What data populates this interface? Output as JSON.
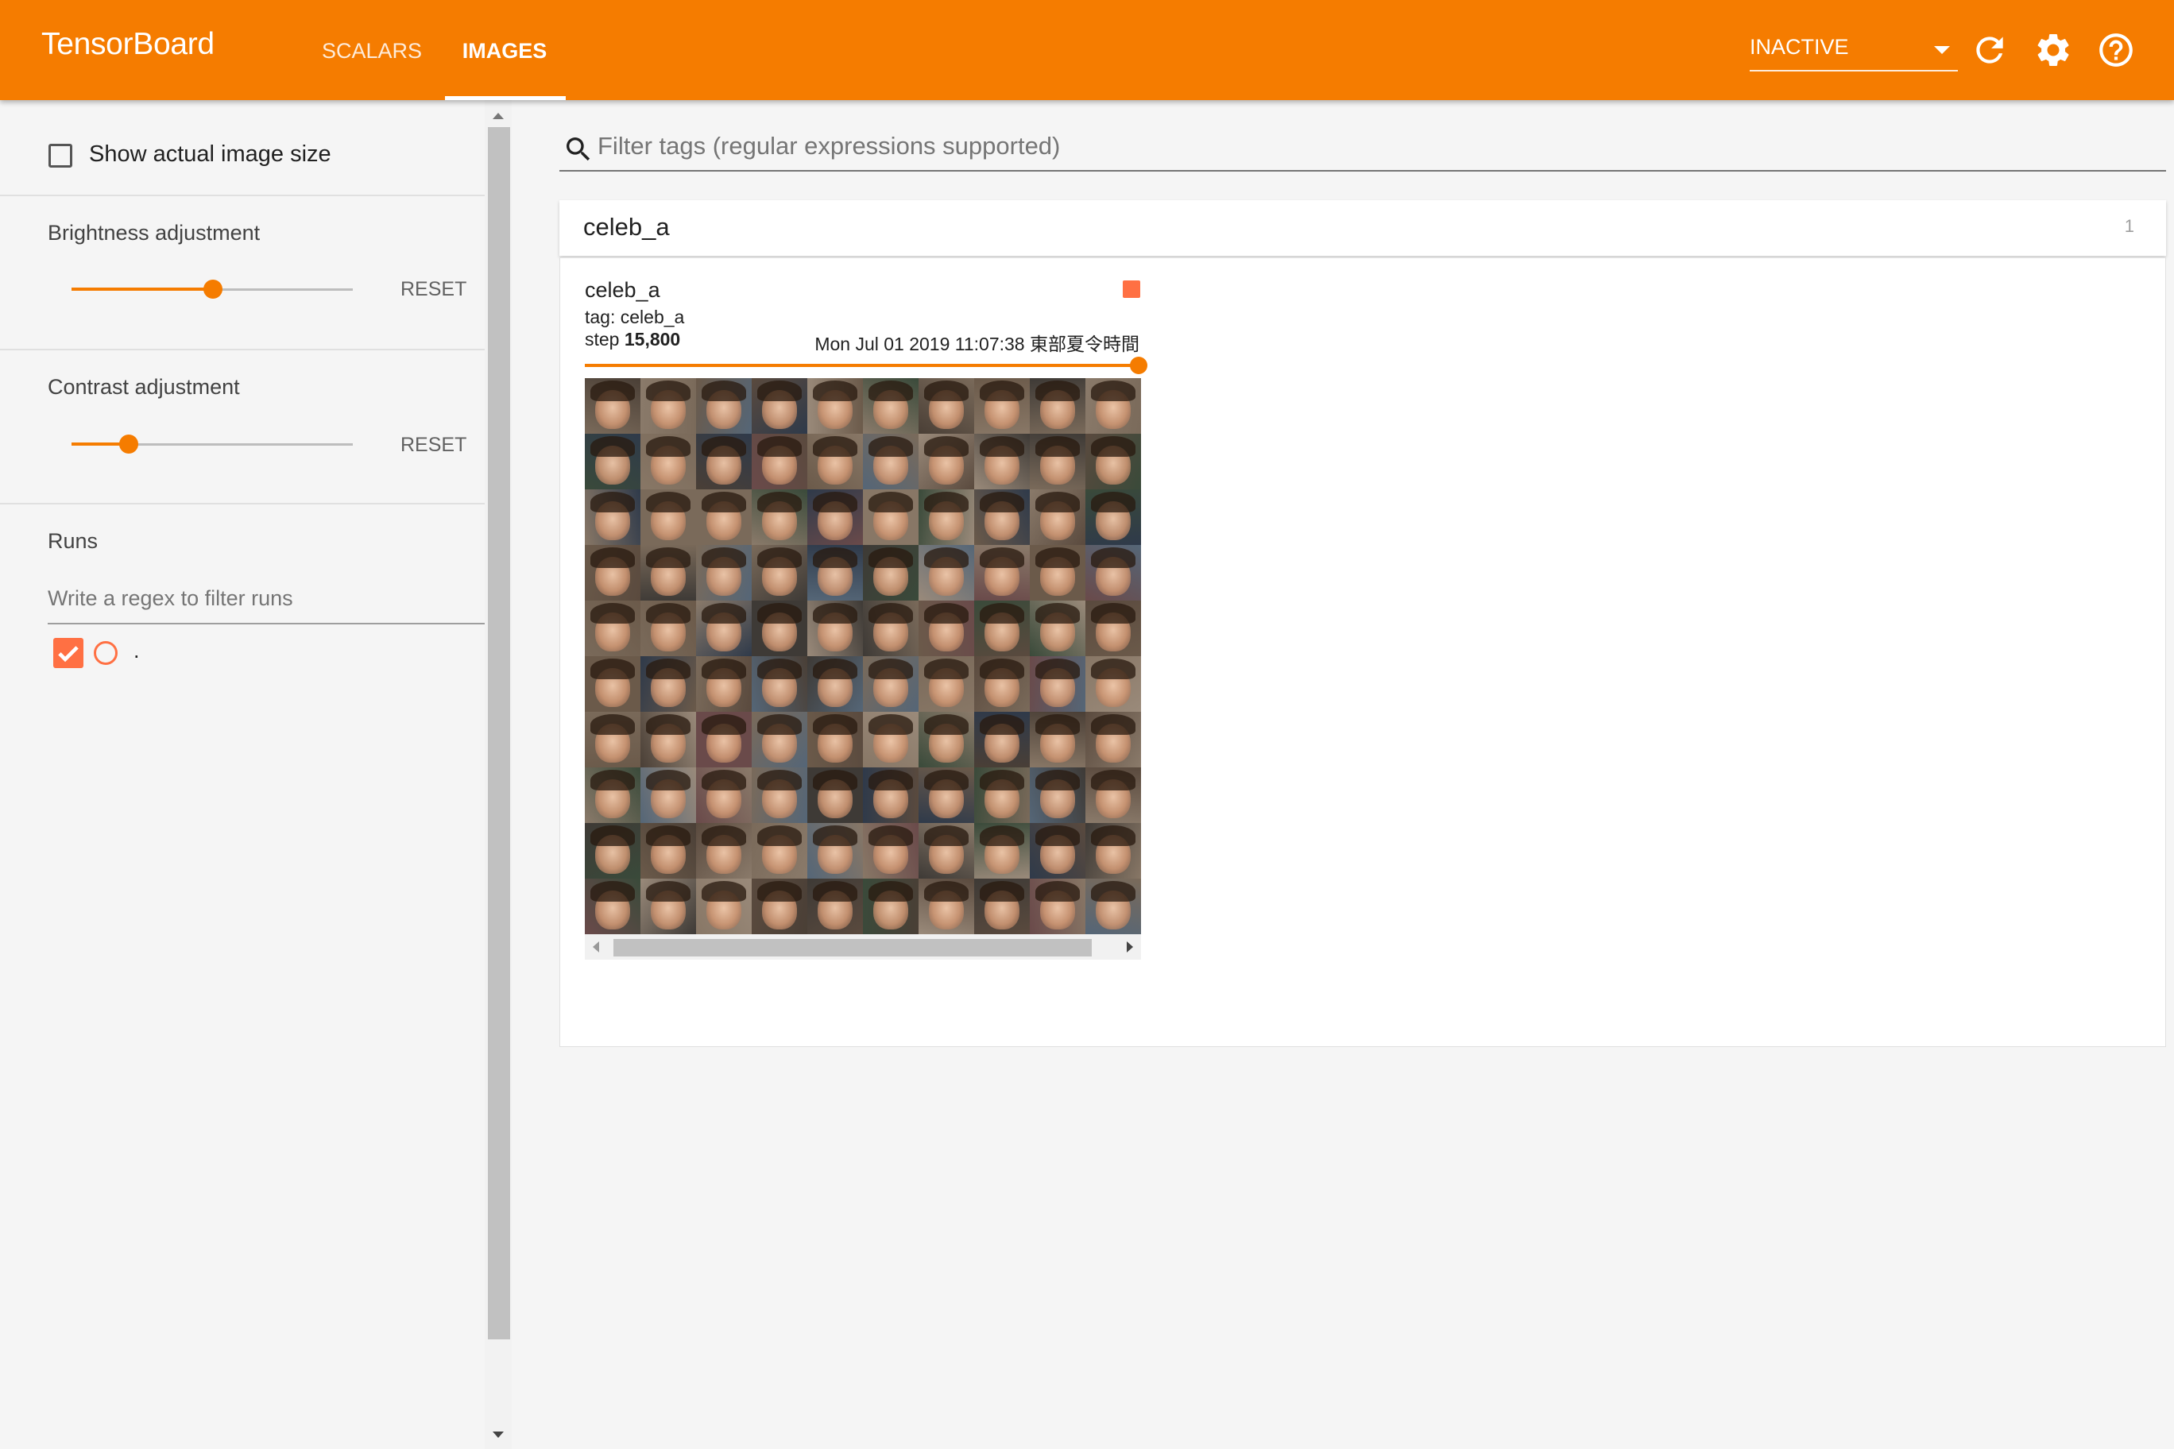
{
  "app": {
    "title": "TensorBoard"
  },
  "nav": {
    "tabs": [
      {
        "label": "SCALARS"
      },
      {
        "label": "IMAGES"
      }
    ],
    "active_tab": "IMAGES"
  },
  "toolbar": {
    "reload_status": "INACTIVE",
    "icons": [
      "refresh-icon",
      "settings-gear-icon",
      "help-circle-icon"
    ]
  },
  "sidebar": {
    "show_actual_size": {
      "label": "Show actual image size",
      "checked": false
    },
    "brightness": {
      "label": "Brightness adjustment",
      "reset_label": "RESET",
      "level": 0.5
    },
    "contrast": {
      "label": "Contrast adjustment",
      "reset_label": "RESET",
      "level": 0.2
    },
    "runs": {
      "title": "Runs",
      "filter_placeholder": "Write a regex to filter runs",
      "items": [
        {
          "name": ".",
          "checked": true,
          "color": "#ff7043"
        }
      ]
    }
  },
  "main": {
    "filter_placeholder": "Filter tags (regular expressions supported)",
    "category": {
      "name": "celeb_a",
      "count": "1",
      "card": {
        "title": "celeb_a",
        "tag_line": "tag: celeb_a",
        "step_prefix": "step",
        "step_value": "15,800",
        "timestamp": "Mon Jul 01 2019 11:07:38 東部夏令時間",
        "step_slider_level": 1.0,
        "image": {
          "description": "10x10 grid of generated celebrity face thumbnails",
          "rows": 10,
          "cols": 10
        }
      }
    }
  },
  "colors": {
    "accent": "#f57c00",
    "run_color": "#ff7043",
    "background": "#f5f5f5"
  }
}
